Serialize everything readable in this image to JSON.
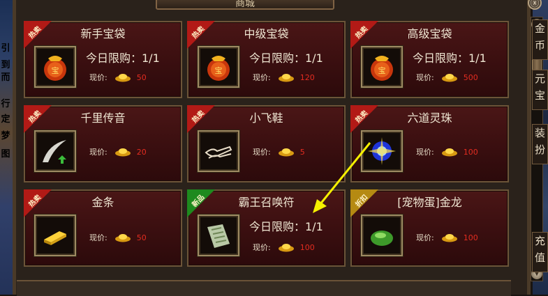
{
  "shop": {
    "title": "商城",
    "close_label": "ⓧ"
  },
  "left_strip": {
    "glyphs": [
      {
        "text": "引",
        "color": "#e8e0c8"
      },
      {
        "text": "到",
        "color": "#e8e0c8"
      },
      {
        "text": "而",
        "color": "#3fa0ff"
      },
      {
        "text": "行",
        "color": "#ffd23a"
      },
      {
        "text": "定",
        "color": "#2fff3f"
      },
      {
        "text": "梦",
        "color": "#ff3dd0"
      },
      {
        "text": "图",
        "color": "#ff3dd0"
      }
    ]
  },
  "items": [
    {
      "badge": "热卖",
      "badge_type": "hot",
      "name": "新手宝袋",
      "limit": "今日限购：1/1",
      "price_label": "现价:",
      "price": "50",
      "icon": "lucky-bag-icon"
    },
    {
      "badge": "热卖",
      "badge_type": "hot",
      "name": "中级宝袋",
      "limit": "今日限购：1/1",
      "price_label": "现价:",
      "price": "120",
      "icon": "lucky-bag-icon"
    },
    {
      "badge": "热卖",
      "badge_type": "hot",
      "name": "高级宝袋",
      "limit": "今日限购：1/1",
      "price_label": "现价:",
      "price": "500",
      "icon": "lucky-bag-icon"
    },
    {
      "badge": "热卖",
      "badge_type": "hot",
      "name": "千里传音",
      "price_label": "现价:",
      "price": "20",
      "icon": "horn-icon"
    },
    {
      "badge": "热卖",
      "badge_type": "hot",
      "name": "小飞鞋",
      "price_label": "现价:",
      "price": "5",
      "icon": "flying-shoe-icon"
    },
    {
      "badge": "热卖",
      "badge_type": "hot",
      "name": "六道灵珠",
      "price_label": "现价:",
      "price": "100",
      "icon": "spirit-orb-icon"
    },
    {
      "badge": "热卖",
      "badge_type": "hot",
      "name": "金条",
      "price_label": "现价:",
      "price": "50",
      "icon": "gold-bar-icon"
    },
    {
      "badge": "新品",
      "badge_type": "new",
      "name": "霸王召唤符",
      "limit": "今日限购：1/1",
      "price_label": "现价:",
      "price": "100",
      "icon": "summon-talisman-icon"
    },
    {
      "badge": "折扣",
      "badge_type": "sale",
      "name": "[宠物蛋]金龙",
      "price_label": "现价:",
      "price": "100",
      "icon": "pet-egg-icon"
    }
  ],
  "side_tabs": [
    {
      "text": "金币"
    },
    {
      "text": "元宝"
    },
    {
      "text": "装扮"
    },
    {
      "text": "充值"
    }
  ],
  "colors": {
    "price": "#e42c20",
    "hot_badge": "#b21a16",
    "new_badge": "#1e8a1e",
    "sale_badge": "#b58a12",
    "annotation_arrow": "#f5f000"
  }
}
